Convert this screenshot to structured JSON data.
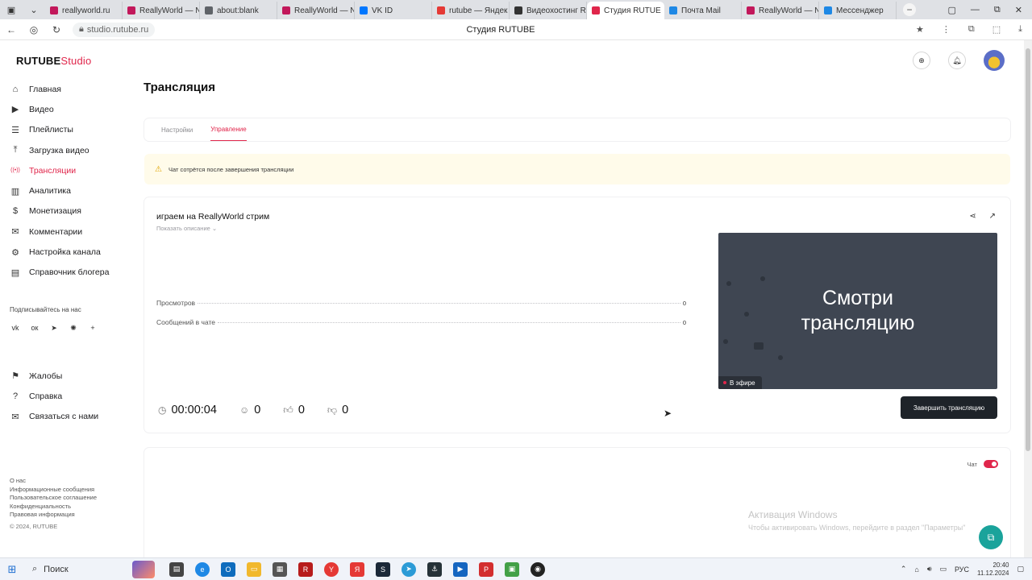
{
  "browser": {
    "tabs": [
      {
        "label": "reallyworld.ru",
        "color": "#c2185b"
      },
      {
        "label": "ReallyWorld — N",
        "color": "#c2185b"
      },
      {
        "label": "about:blank",
        "color": "#5f6368"
      },
      {
        "label": "ReallyWorld — N",
        "color": "#c2185b"
      },
      {
        "label": "VK ID",
        "color": "#0077ff"
      },
      {
        "label": "rutube — Яндек",
        "color": "#e53935"
      },
      {
        "label": "Видеохостинг R",
        "color": "#333333"
      },
      {
        "label": "Студия RUTUE",
        "color": "#e0264b",
        "active": true
      },
      {
        "label": "Почта Mail",
        "color": "#1e88e5"
      },
      {
        "label": "ReallyWorld — N",
        "color": "#c2185b"
      },
      {
        "label": "Мессенджер",
        "color": "#1e88e5"
      }
    ],
    "url": "studio.rutube.ru",
    "page_title": "Студия RUTUBE"
  },
  "app": {
    "logo_main": "RUTUBE",
    "logo_accent": "Studio",
    "accent_color": "#e0264b"
  },
  "sidebar": {
    "items": [
      {
        "label": "Главная",
        "icon": "home-icon"
      },
      {
        "label": "Видео",
        "icon": "video-icon"
      },
      {
        "label": "Плейлисты",
        "icon": "playlist-icon"
      },
      {
        "label": "Загрузка видео",
        "icon": "upload-icon"
      },
      {
        "label": "Трансляции",
        "icon": "broadcast-icon",
        "active": true
      },
      {
        "label": "Аналитика",
        "icon": "analytics-icon"
      },
      {
        "label": "Монетизация",
        "icon": "monetization-icon"
      },
      {
        "label": "Комментарии",
        "icon": "comments-icon"
      },
      {
        "label": "Настройка канала",
        "icon": "gear-icon"
      },
      {
        "label": "Справочник блогера",
        "icon": "book-icon"
      }
    ],
    "subscribe_label": "Подписывайтесь на нас",
    "socials": [
      "vk-icon",
      "ok-icon",
      "telegram-icon",
      "dzen-icon",
      "more-icon"
    ],
    "support_items": [
      {
        "label": "Жалобы",
        "icon": "flag-icon"
      },
      {
        "label": "Справка",
        "icon": "help-icon"
      },
      {
        "label": "Связаться с нами",
        "icon": "mail-icon"
      }
    ],
    "footer_links": [
      "О нас",
      "Информационные сообщения",
      "Пользовательское соглашение",
      "Конфиденциальность",
      "Правовая информация"
    ],
    "copyright": "© 2024, RUTUBE"
  },
  "page": {
    "title": "Трансляция",
    "tabs": [
      {
        "label": "Настройки"
      },
      {
        "label": "Управление",
        "active": true
      }
    ],
    "warning": "Чат сотрётся после завершения трансляции"
  },
  "stream": {
    "title": "играем на ReallyWorld стрим",
    "show_description": "Показать описание",
    "stats": [
      {
        "label": "Просмотров",
        "value": "0"
      },
      {
        "label": "Сообщений в чате",
        "value": "0"
      }
    ],
    "preview_text_line1": "Смотри",
    "preview_text_line2": "трансляцию",
    "live_badge": "В эфире",
    "duration": "00:00:04",
    "viewers": "0",
    "likes": "0",
    "dislikes": "0",
    "finish_button": "Завершить трансляцию"
  },
  "chat": {
    "toggle_label": "Чат",
    "enabled": true
  },
  "windows_activation": {
    "title": "Активация Windows",
    "subtitle": "Чтобы активировать Windows, перейдите в раздел \"Параметры\""
  },
  "taskbar": {
    "search_label": "Поиск",
    "language": "РУС",
    "time": "20:40",
    "date": "11.12.2024"
  }
}
